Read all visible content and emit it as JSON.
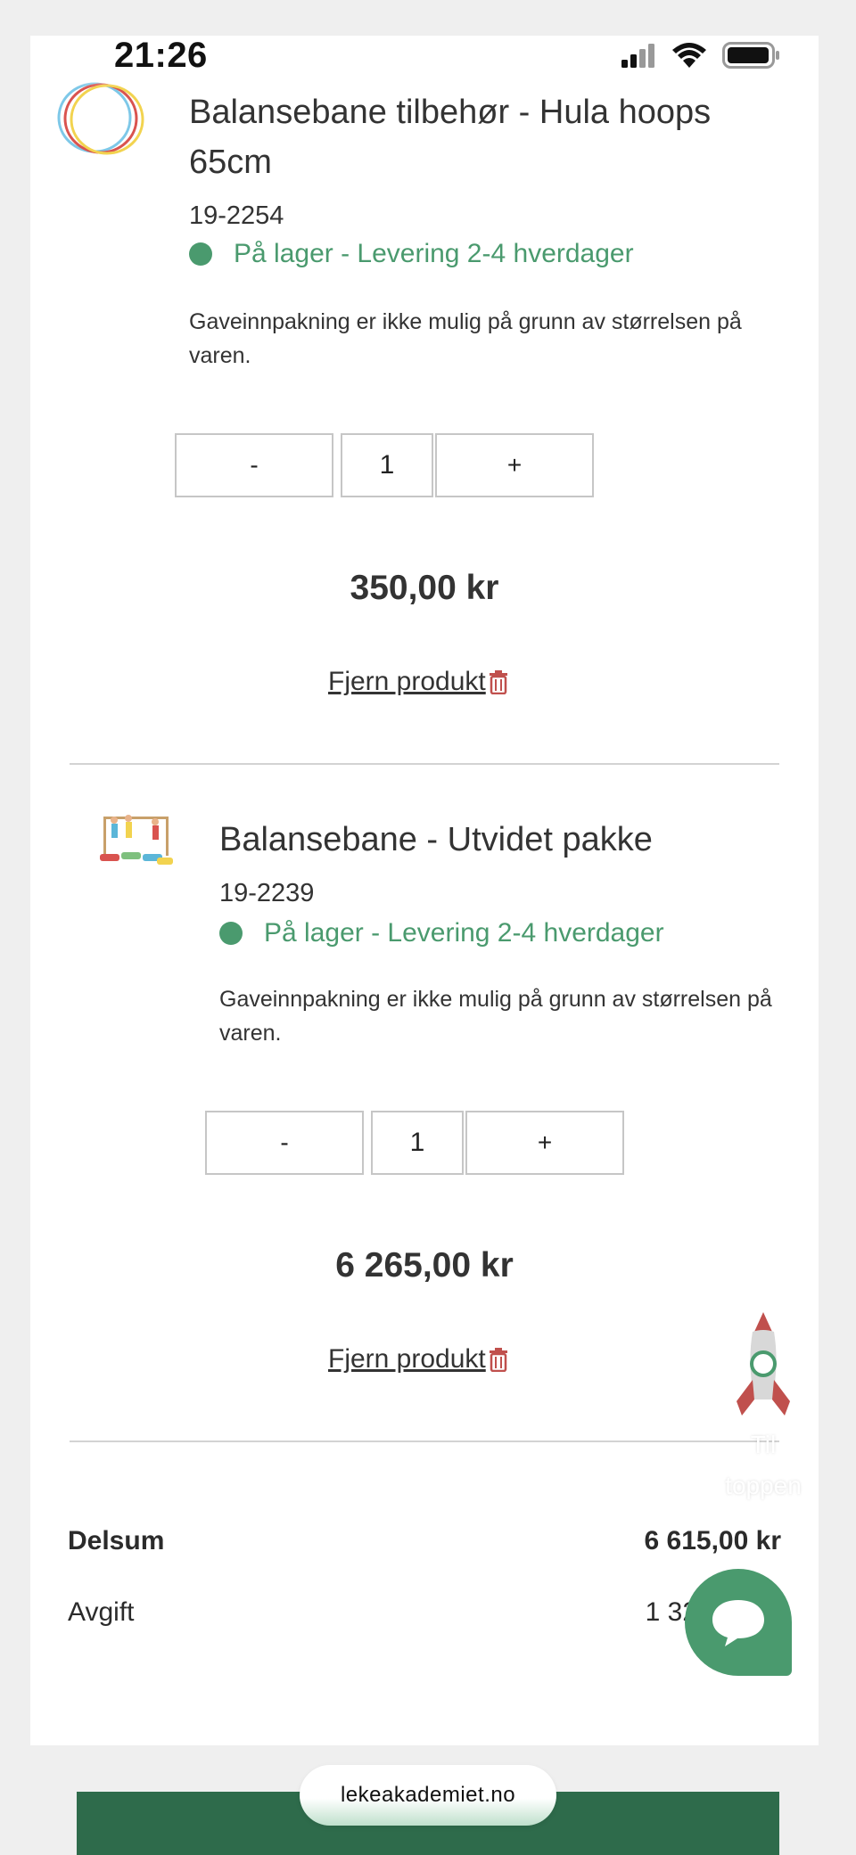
{
  "status_bar": {
    "time": "21:26"
  },
  "products": [
    {
      "title": "Balansebane tilbehør - Hula hoops 65cm",
      "sku": "19-2254",
      "stock": "På lager - Levering 2-4 hverdager",
      "note": "Gaveinnpakning er ikke mulig på grunn av størrelsen på varen.",
      "qty_minus": "-",
      "qty_value": "1",
      "qty_plus": "+",
      "price": "350,00 kr",
      "remove_label": "Fjern produkt",
      "image_icon": "hula-hoops-image"
    },
    {
      "title": "Balansebane - Utvidet pakke",
      "sku": "19-2239",
      "stock": "På lager - Levering 2-4 hverdager",
      "note": "Gaveinnpakning er ikke mulig på grunn av størrelsen på varen.",
      "qty_minus": "-",
      "qty_value": "1",
      "qty_plus": "+",
      "price": "6 265,00 kr",
      "remove_label": "Fjern produkt",
      "image_icon": "balance-course-image"
    }
  ],
  "summary": {
    "subtotal_label": "Delsum",
    "subtotal_value": "6 615,00 kr",
    "fee_label": "Avgift",
    "fee_value": "1 32"
  },
  "to_top": {
    "line1": "Til",
    "line2": "toppen"
  },
  "browser": {
    "url": "lekeakademiet.no"
  },
  "colors": {
    "accent": "#4a9a6e",
    "footer": "#2e6b4b",
    "trash": "#c0504d"
  }
}
